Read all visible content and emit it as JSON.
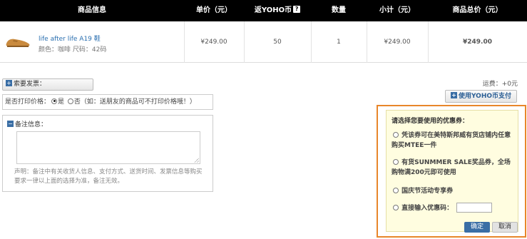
{
  "header": {
    "product_info": "商品信息",
    "unit_price": "单价（元）",
    "yoho_coin": "返YOHO币",
    "yoho_help": "?",
    "quantity": "数量",
    "subtotal": "小计（元）",
    "total": "商品总价（元）"
  },
  "product": {
    "name": "life after life A19 鞋",
    "meta": "颜色：咖啡 尺码：42码",
    "unit_price": "¥249.00",
    "coins": "50",
    "quantity": "1",
    "subtotal": "¥249.00",
    "total": "¥249.00"
  },
  "invoice": {
    "label": "索要发票：",
    "icon": "plus-icon"
  },
  "print_price": {
    "label": "是否打印价格：",
    "yes": "是",
    "no": "否（如：送朋友的商品可不打印价格哦！）",
    "selected": "是"
  },
  "note": {
    "title": "备注信息：",
    "icon": "minus-icon",
    "value": "",
    "desc": "声明：备注中有关收货人信息、支付方式、送货时间、发票信息等购买要求一律以上面的选择为准，备注无效。"
  },
  "shipping": "运费：+0元",
  "yoho_pay_button": "使用YOHO币支付",
  "coupon": {
    "title": "请选择您要使用的优惠券：",
    "options": [
      "凭该券可在美特斯邦威有货店铺内任意购买MTEE一件",
      "有货SUNMMER SALE奖品券，全场购物满200元即可使用",
      "国庆节活动专享券",
      "直接输入优惠码："
    ],
    "code_value": "",
    "ok": "确定",
    "cancel": "取消"
  },
  "colors": {
    "header_bg": "#000000",
    "accent": "#e8862a",
    "link": "#2a6fb0",
    "button_blue": "#3a6ea5",
    "coupon_bg": "#fffde0"
  }
}
